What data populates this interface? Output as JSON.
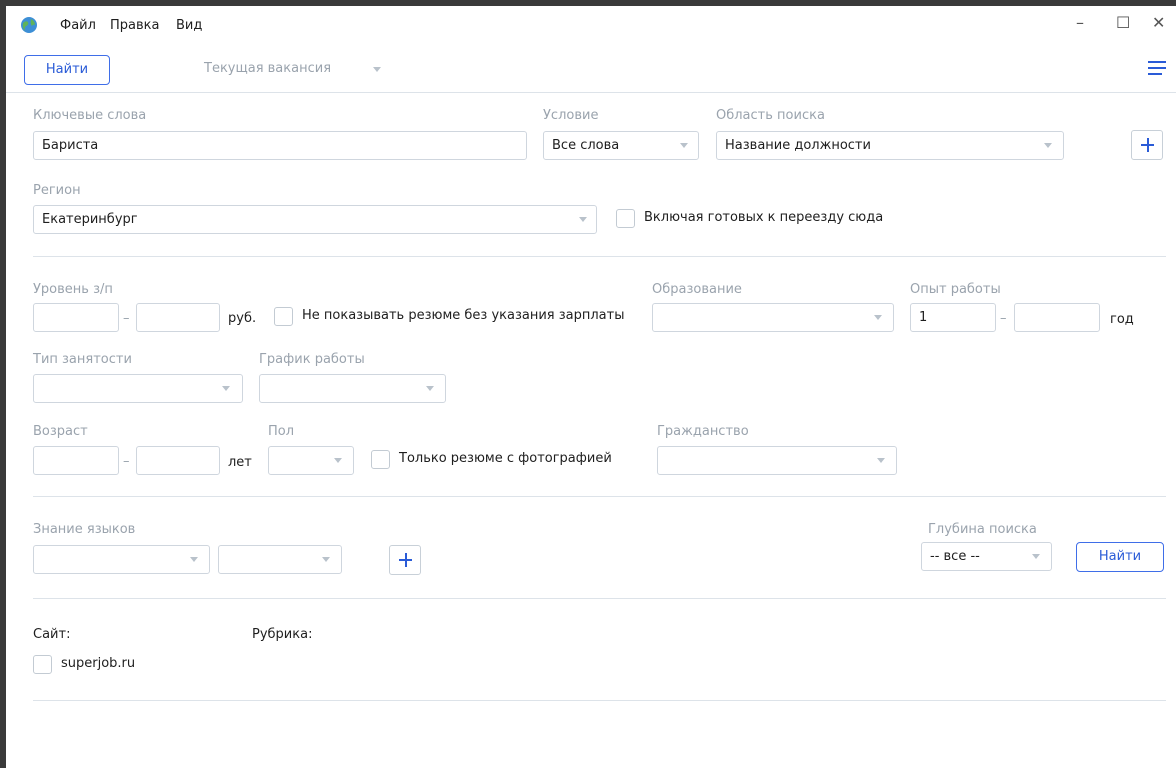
{
  "menu": {
    "file": "Файл",
    "edit": "Правка",
    "view": "Вид"
  },
  "window_controls": {
    "minimize": "–",
    "maximize": "☐",
    "close": "✕"
  },
  "toolbar": {
    "find_label": "Найти",
    "vacancy_label": "Текущая вакансия"
  },
  "search": {
    "keywords_label": "Ключевые слова",
    "keywords_value": "Бариста",
    "condition_label": "Условие",
    "condition_value": "Все слова",
    "scope_label": "Область поиска",
    "scope_value": "Название должности"
  },
  "region": {
    "label": "Регион",
    "value": "Екатеринбург",
    "relocate_label": "Включая готовых к переезду сюда"
  },
  "salary": {
    "label": "Уровень з/п",
    "from": "",
    "to": "",
    "dash": "–",
    "unit": "руб.",
    "hide_no_salary_label": "Не показывать резюме без указания зарплаты"
  },
  "education": {
    "label": "Образование",
    "value": ""
  },
  "experience": {
    "label": "Опыт работы",
    "from": "1",
    "to": "",
    "dash": "–",
    "unit": "год"
  },
  "employment": {
    "label": "Тип занятости",
    "value": ""
  },
  "schedule": {
    "label": "График работы",
    "value": ""
  },
  "age": {
    "label": "Возраст",
    "from": "",
    "to": "",
    "dash": "–",
    "unit": "лет"
  },
  "gender": {
    "label": "Пол",
    "value": ""
  },
  "photo_only_label": "Только резюме с фотографией",
  "citizenship": {
    "label": "Гражданство",
    "value": ""
  },
  "languages": {
    "label": "Знание языков",
    "lang_value": "",
    "level_value": ""
  },
  "depth": {
    "label": "Глубина поиска",
    "value": "-- все --",
    "find_label": "Найти"
  },
  "sources": {
    "site_label": "Сайт:",
    "rubric_label": "Рубрика:",
    "sites": [
      "superjob.ru"
    ]
  },
  "colors": {
    "accent": "#2a5bd7",
    "muted_text": "#9aa3ad",
    "border": "#cfd6de"
  }
}
